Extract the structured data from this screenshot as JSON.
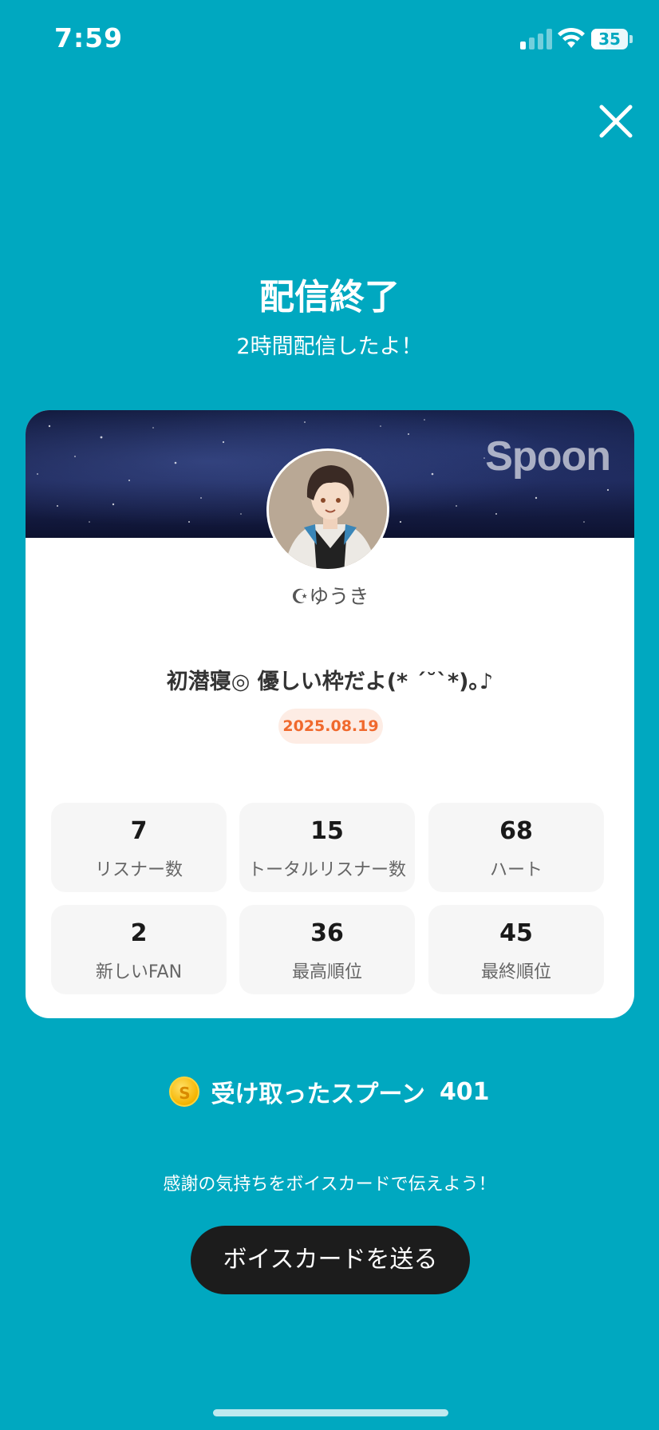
{
  "status_bar": {
    "time": "7:59",
    "battery": "35"
  },
  "header": {
    "title": "配信終了",
    "subtitle": "2時間配信したよ！",
    "close_icon": "close-icon"
  },
  "card": {
    "brand": "Spoon",
    "username": "☪︎ゆうき",
    "live_title": "初潜寝◎ 優しい枠だよ(* ˊ˘ˋ*)｡♪",
    "date": "2025.08.19",
    "stats": [
      {
        "value": "7",
        "label": "リスナー数"
      },
      {
        "value": "15",
        "label": "トータルリスナー数"
      },
      {
        "value": "68",
        "label": "ハート"
      },
      {
        "value": "2",
        "label": "新しいFAN"
      },
      {
        "value": "36",
        "label": "最高順位"
      },
      {
        "value": "45",
        "label": "最終順位"
      }
    ]
  },
  "spoons": {
    "coin_symbol": "S",
    "label": "受け取ったスプーン",
    "count": "401"
  },
  "footer": {
    "thanks_text": "感謝の気持ちをボイスカードで伝えよう！",
    "button_label": "ボイスカードを送る"
  },
  "colors": {
    "background": "#00a8c0",
    "button": "#1c1c1c",
    "date_accent": "#f0692d"
  }
}
